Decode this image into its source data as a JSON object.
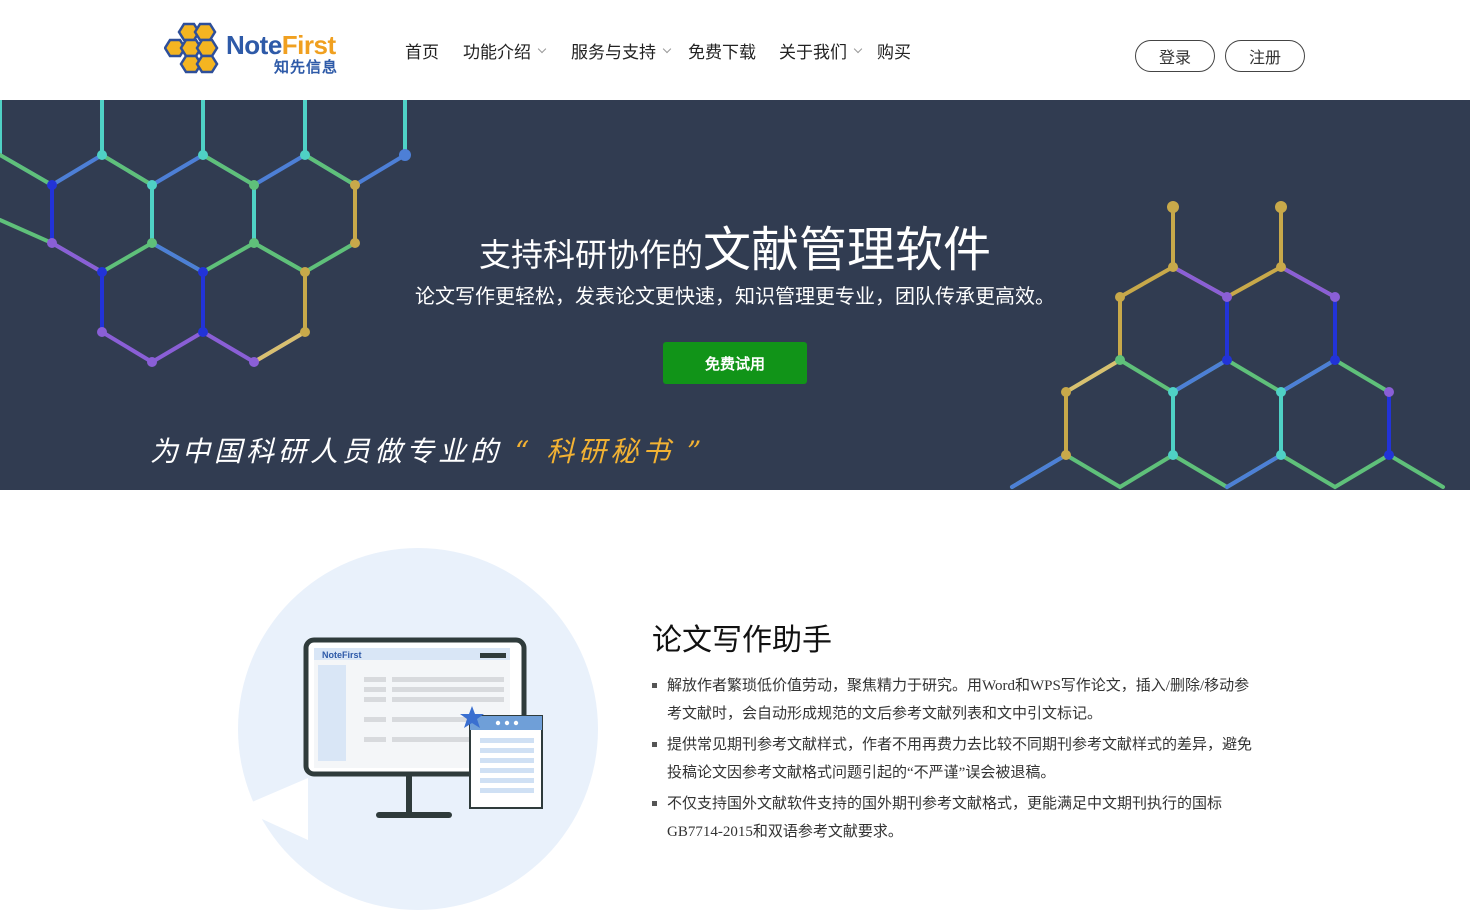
{
  "header": {
    "logo": {
      "word_note": "Note",
      "word_first": "First",
      "sub": "知先信息"
    },
    "nav": [
      {
        "label": "首页",
        "dropdown": false
      },
      {
        "label": "功能介绍",
        "dropdown": true
      },
      {
        "label": "服务与支持",
        "dropdown": true
      },
      {
        "label": "免费下载",
        "dropdown": false
      },
      {
        "label": "关于我们",
        "dropdown": true
      },
      {
        "label": "购买",
        "dropdown": false
      }
    ],
    "login_label": "登录",
    "register_label": "注册"
  },
  "banner": {
    "headline_small": "支持科研协作的",
    "headline_big": "文献管理软件",
    "subline": "论文写作更轻松，发表论文更快速，知识管理更专业，团队传承更高效。",
    "trial_label": "免费试用",
    "slogan_prefix": "为中国科研人员做专业的",
    "slogan_highlight": "“ 科研秘书 ”",
    "colors": {
      "background": "#313c51",
      "trial": "#119418",
      "slogan_highlight": "#f2b233"
    }
  },
  "feature": {
    "illustration_brand": "NoteFirst",
    "title": "论文写作助手",
    "items": [
      "解放作者繁琐低价值劳动，聚焦精力于研究。用Word和WPS写作论文，插入/删除/移动参考文献时，会自动形成规范的文后参考文献列表和文中引文标记。",
      "提供常见期刊参考文献样式，作者不用再费力去比较不同期刊参考文献样式的差异，避免投稿论文因参考文献格式问题引起的“不严谨”误会被退稿。",
      "不仅支持国外文献软件支持的国外期刊参考文献格式，更能满足中文期刊执行的国标GB7714-2015和双语参考文献要求。"
    ]
  }
}
